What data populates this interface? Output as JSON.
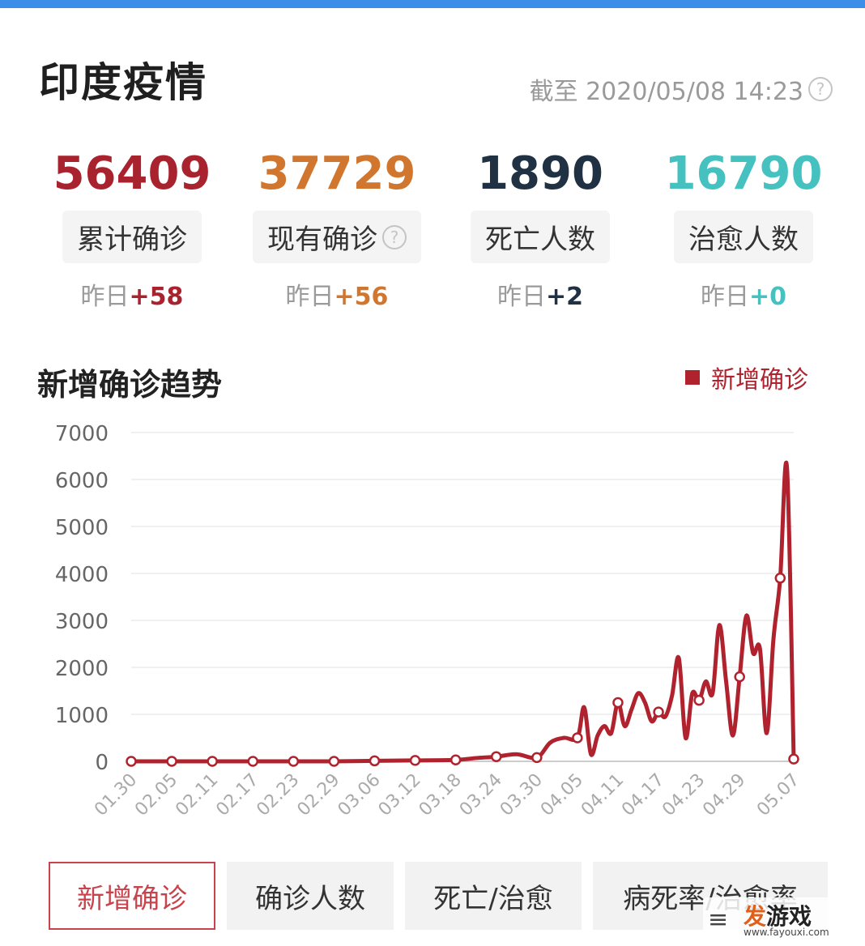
{
  "header": {
    "title": "印度疫情",
    "update_time": "截至 2020/05/08 14:23",
    "help_symbol": "?"
  },
  "stats": [
    {
      "value": "56409",
      "label": "累计确诊",
      "delta_prefix": "昨日",
      "delta": "+58",
      "color": "#a8232e",
      "has_help": false
    },
    {
      "value": "37729",
      "label": "现有确诊",
      "delta_prefix": "昨日",
      "delta": "+56",
      "color": "#d0762e",
      "has_help": true
    },
    {
      "value": "1890",
      "label": "死亡人数",
      "delta_prefix": "昨日",
      "delta": "+2",
      "color": "#1f3142",
      "has_help": false
    },
    {
      "value": "16790",
      "label": "治愈人数",
      "delta_prefix": "昨日",
      "delta": "+0",
      "color": "#45c1c0",
      "has_help": false
    }
  ],
  "chart_section": {
    "title": "新增确诊趋势",
    "legend_label": "新增确诊"
  },
  "chart_data": {
    "type": "line",
    "xlabel": "",
    "ylabel": "",
    "ylim": [
      0,
      7000
    ],
    "y_ticks": [
      "0",
      "1000",
      "2000",
      "3000",
      "4000",
      "5000",
      "6000",
      "7000"
    ],
    "x_tick_labels": [
      "01.30",
      "02.05",
      "02.11",
      "02.17",
      "02.23",
      "02.29",
      "03.06",
      "03.12",
      "03.18",
      "03.24",
      "03.30",
      "04.05",
      "04.11",
      "04.17",
      "04.23",
      "04.29",
      "05.07"
    ],
    "grid": true,
    "legend_position": "top-right",
    "series": [
      {
        "name": "新增确诊",
        "color": "#b0232e",
        "points": [
          [
            "01.30",
            0
          ],
          [
            "02.05",
            0
          ],
          [
            "02.11",
            0
          ],
          [
            "02.17",
            0
          ],
          [
            "02.23",
            0
          ],
          [
            "02.29",
            0
          ],
          [
            "03.06",
            10
          ],
          [
            "03.12",
            20
          ],
          [
            "03.18",
            30
          ],
          [
            "03.21",
            70
          ],
          [
            "03.24",
            100
          ],
          [
            "03.27",
            150
          ],
          [
            "03.30",
            80
          ],
          [
            "04.01",
            400
          ],
          [
            "04.03",
            500
          ],
          [
            "04.05",
            500
          ],
          [
            "04.06",
            1150
          ],
          [
            "04.07",
            150
          ],
          [
            "04.08",
            550
          ],
          [
            "04.09",
            750
          ],
          [
            "04.10",
            600
          ],
          [
            "04.11",
            1250
          ],
          [
            "04.12",
            750
          ],
          [
            "04.13",
            1100
          ],
          [
            "04.14",
            1450
          ],
          [
            "04.15",
            1250
          ],
          [
            "04.16",
            850
          ],
          [
            "04.17",
            1050
          ],
          [
            "04.18",
            950
          ],
          [
            "04.19",
            1400
          ],
          [
            "04.20",
            2200
          ],
          [
            "04.21",
            500
          ],
          [
            "04.22",
            1450
          ],
          [
            "04.23",
            1300
          ],
          [
            "04.24",
            1700
          ],
          [
            "04.25",
            1450
          ],
          [
            "04.26",
            2900
          ],
          [
            "04.27",
            1700
          ],
          [
            "04.28",
            550
          ],
          [
            "04.29",
            1800
          ],
          [
            "04.30",
            3100
          ],
          [
            "05.01",
            2300
          ],
          [
            "05.02",
            2400
          ],
          [
            "05.03",
            600
          ],
          [
            "05.04",
            2600
          ],
          [
            "05.05",
            3900
          ],
          [
            "05.06",
            6250
          ],
          [
            "05.07",
            50
          ]
        ],
        "marked_points": [
          "01.30",
          "02.05",
          "02.11",
          "02.17",
          "02.23",
          "02.29",
          "03.06",
          "03.12",
          "03.18",
          "03.24",
          "03.30",
          "04.05",
          "04.11",
          "04.17",
          "04.23",
          "04.29",
          "05.05",
          "05.07"
        ]
      }
    ]
  },
  "tabs": [
    {
      "label": "新增确诊",
      "active": true
    },
    {
      "label": "确诊人数",
      "active": false
    },
    {
      "label": "死亡/治愈",
      "active": false
    },
    {
      "label": "病死率/治愈率",
      "active": false
    }
  ],
  "watermark": {
    "logo_prefix": "发",
    "logo_suffix": "游戏",
    "url": "www.fayouxi.com"
  }
}
